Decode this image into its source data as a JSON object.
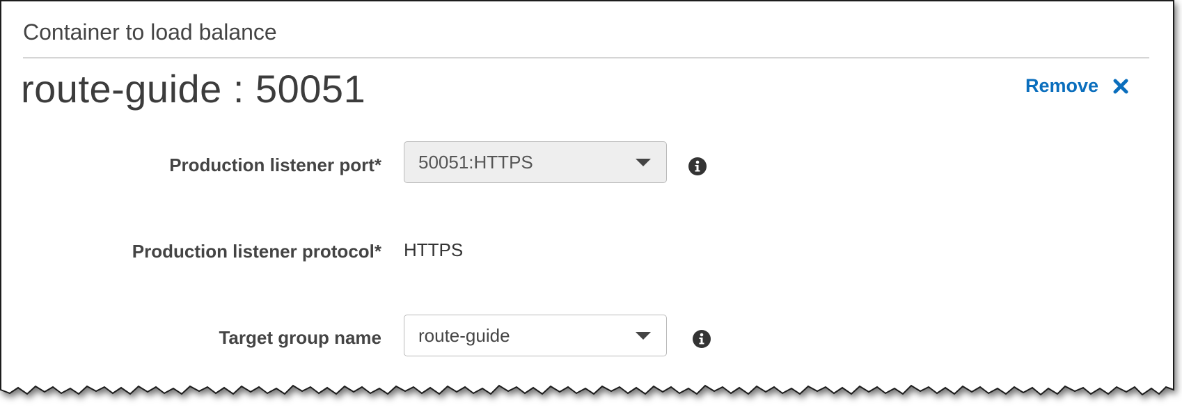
{
  "section": {
    "title": "Container to load balance"
  },
  "container": {
    "name": "route-guide : 50051"
  },
  "remove": {
    "label": "Remove",
    "icon": "close-icon",
    "color": "#0a6ebd"
  },
  "fields": {
    "listener_port": {
      "label": "Production listener port*",
      "value": "50051:HTTPS",
      "disabled": true,
      "info_icon": "info-icon"
    },
    "listener_protocol": {
      "label": "Production listener protocol*",
      "value": "HTTPS"
    },
    "target_group": {
      "label": "Target group name",
      "value": "route-guide",
      "info_icon": "info-icon"
    }
  }
}
